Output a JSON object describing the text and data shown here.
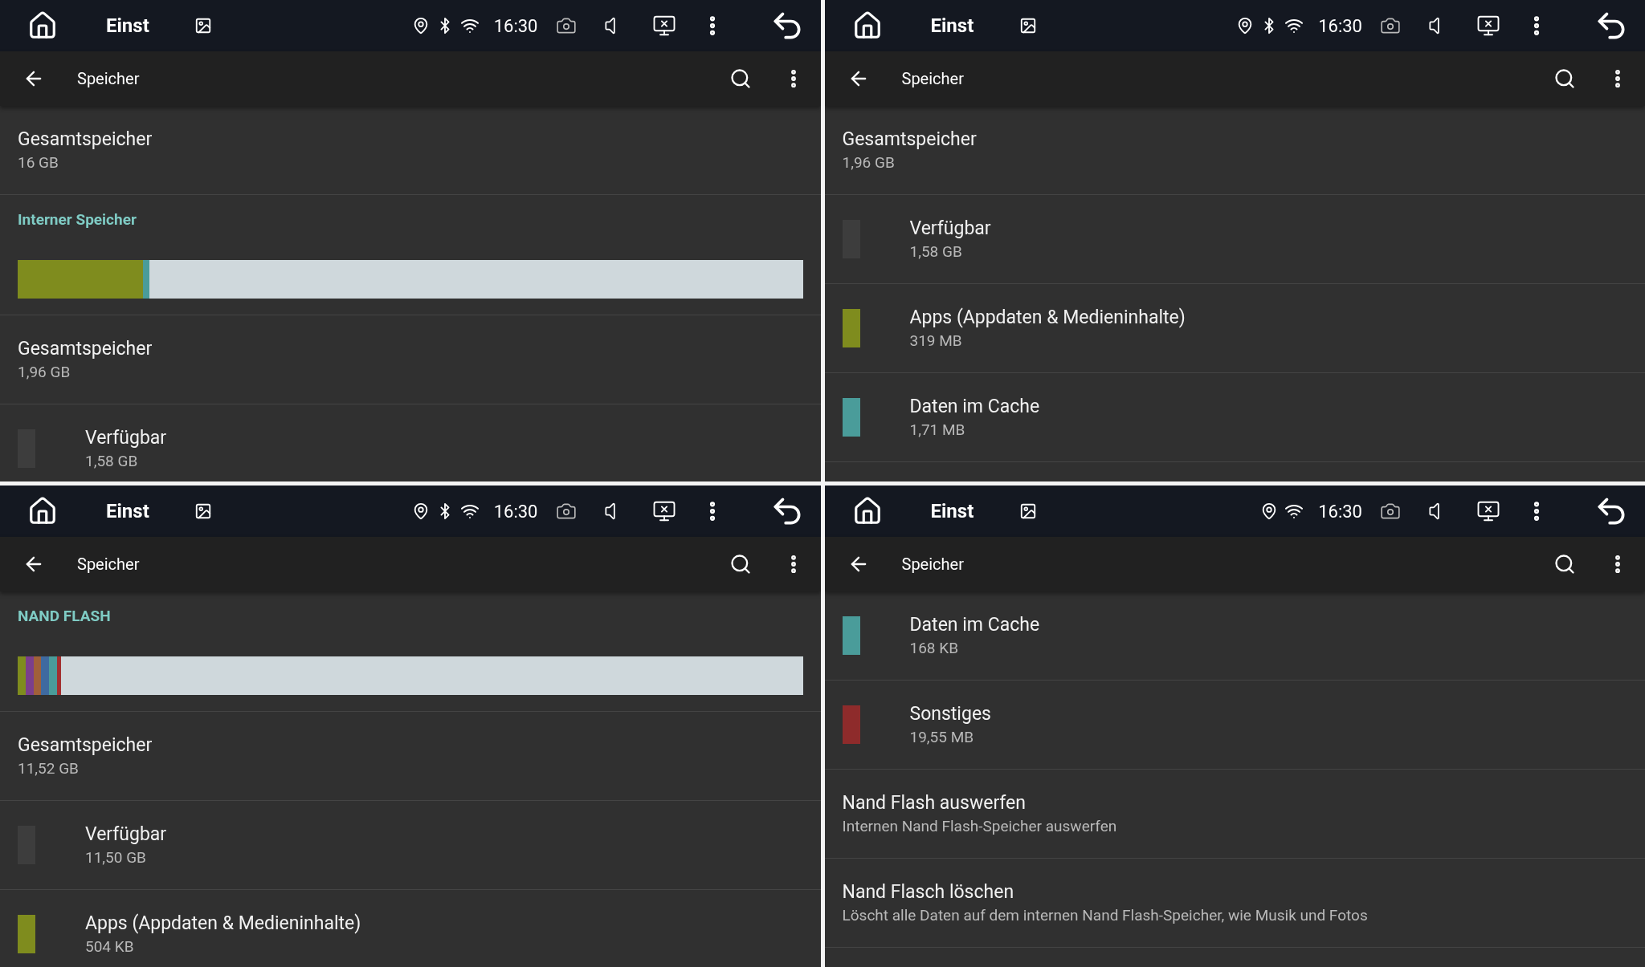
{
  "panels": [
    {
      "status": {
        "title": "Einst",
        "time": "16:30",
        "bluetooth": true
      },
      "app_bar": {
        "title": "Speicher"
      },
      "items": [
        {
          "kind": "summary",
          "title": "Gesamtspeicher",
          "subtitle": "16 GB"
        },
        {
          "kind": "header",
          "title": "Interner Speicher"
        },
        {
          "kind": "bar",
          "segments": [
            {
              "color": "#7f8c1e",
              "level": 0.16
            },
            {
              "color": "#4a9c9a",
              "level": 0.008
            }
          ]
        },
        {
          "kind": "summary",
          "title": "Gesamtspeicher",
          "subtitle": "1,96 GB"
        },
        {
          "kind": "category",
          "title": "Verfügbar",
          "subtitle": "1,58 GB",
          "color": "#3d3d3d"
        }
      ]
    },
    {
      "status": {
        "title": "Einst",
        "time": "16:30",
        "bluetooth": true
      },
      "app_bar": {
        "title": "Speicher"
      },
      "items": [
        {
          "kind": "summary",
          "title": "Gesamtspeicher",
          "subtitle": "1,96 GB"
        },
        {
          "kind": "category",
          "title": "Verfügbar",
          "subtitle": "1,58 GB",
          "color": "#3d3d3d"
        },
        {
          "kind": "category",
          "title": "Apps (Appdaten & Medieninhalte)",
          "subtitle": "319 MB",
          "color": "#7f8c1e"
        },
        {
          "kind": "category",
          "title": "Daten im Cache",
          "subtitle": "1,71 MB",
          "color": "#4a9c9a"
        }
      ]
    },
    {
      "status": {
        "title": "Einst",
        "time": "16:30",
        "bluetooth": true
      },
      "app_bar": {
        "title": "Speicher"
      },
      "items": [
        {
          "kind": "header",
          "title": "NAND FLASH"
        },
        {
          "kind": "bar",
          "segments": [
            {
              "color": "#7f8c1e",
              "level": 0.01
            },
            {
              "color": "#7b3f8c",
              "level": 0.01
            },
            {
              "color": "#a0603a",
              "level": 0.01
            },
            {
              "color": "#3f6aa0",
              "level": 0.01
            },
            {
              "color": "#4a9c9a",
              "level": 0.01
            },
            {
              "color": "#a33030",
              "level": 0.005
            }
          ]
        },
        {
          "kind": "summary",
          "title": "Gesamtspeicher",
          "subtitle": "11,52 GB"
        },
        {
          "kind": "category",
          "title": "Verfügbar",
          "subtitle": "11,50 GB",
          "color": "#3d3d3d"
        },
        {
          "kind": "category",
          "title": "Apps (Appdaten & Medieninhalte)",
          "subtitle": "504 KB",
          "color": "#7f8c1e"
        }
      ]
    },
    {
      "status": {
        "title": "Einst",
        "time": "16:30",
        "bluetooth": false
      },
      "app_bar": {
        "title": "Speicher"
      },
      "items": [
        {
          "kind": "category",
          "title": "Daten im Cache",
          "subtitle": "168 KB",
          "color": "#4a9c9a"
        },
        {
          "kind": "category",
          "title": "Sonstiges",
          "subtitle": "19,55 MB",
          "color": "#8e2b2b"
        },
        {
          "kind": "action",
          "title": "Nand Flash auswerfen",
          "subtitle": "Internen Nand Flash-Speicher auswerfen"
        },
        {
          "kind": "action",
          "title": "Nand Flasch löschen",
          "subtitle": "Löscht alle Daten auf dem internen Nand Flash-Speicher, wie Musik und Fotos"
        }
      ]
    }
  ]
}
